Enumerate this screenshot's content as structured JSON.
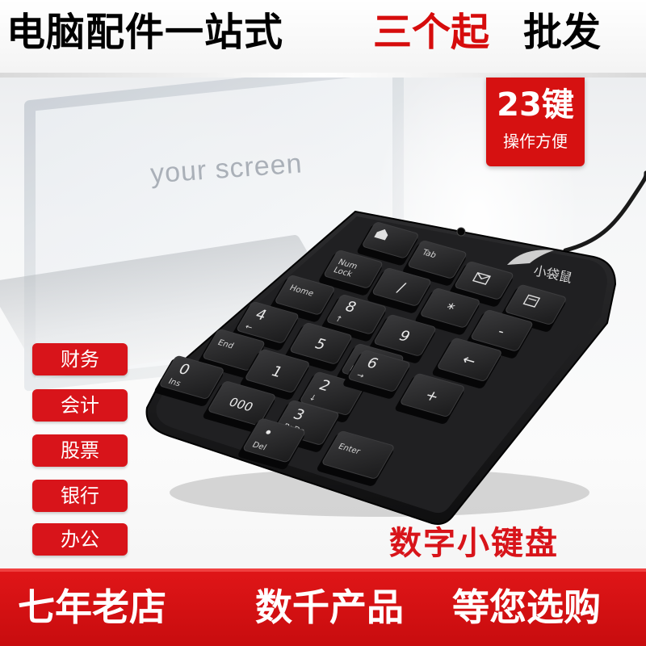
{
  "top_banner": {
    "part1": "电脑配件一站式",
    "part2": "三个起",
    "part3": "批发",
    "accent_color": "#d60c0c"
  },
  "badge": {
    "main": "23键",
    "sub": "操作方便"
  },
  "scene": {
    "screen_text": "your screen"
  },
  "keypad": {
    "brand": "小袋鼠",
    "keys": [
      {
        "main": "",
        "sub": "",
        "icon": "home-icon"
      },
      {
        "main": "",
        "sub": "Tab"
      },
      {
        "main": "",
        "sub": "",
        "icon": "mail-icon"
      },
      {
        "main": "",
        "sub": "",
        "icon": "calculator-icon"
      },
      {
        "main": "",
        "sub": "Num Lock"
      },
      {
        "main": "/",
        "sub": ""
      },
      {
        "main": "*",
        "sub": ""
      },
      {
        "main": "-",
        "sub": ""
      },
      {
        "main": "",
        "sub": "Home"
      },
      {
        "main": "8",
        "sub": "↑"
      },
      {
        "main": "9",
        "sub": ""
      },
      {
        "main": "←",
        "sub": ""
      },
      {
        "main": "4",
        "sub": "←"
      },
      {
        "main": "5",
        "sub": ""
      },
      {
        "main": "6",
        "sub": "PgUp"
      },
      {
        "main": "",
        "sub": "End"
      },
      {
        "main": "1",
        "sub": ""
      },
      {
        "main": "2",
        "sub": "↓"
      },
      {
        "main": "6",
        "sub": "→"
      },
      {
        "main": "+",
        "sub": ""
      },
      {
        "main": "0",
        "sub": "Ins"
      },
      {
        "main": "000",
        "sub": ""
      },
      {
        "main": "3",
        "sub": "PgDn"
      },
      {
        "main": "•",
        "sub": "Del"
      },
      {
        "main": "",
        "sub": "Enter"
      }
    ]
  },
  "tags": [
    "财务",
    "会计",
    "股票",
    "银行",
    "办公"
  ],
  "product_name": "数字小键盘",
  "bottom_banner": {
    "part1": "七年老店",
    "part2": "数千产品",
    "part3": "等您选购",
    "color": "#d8141a"
  }
}
